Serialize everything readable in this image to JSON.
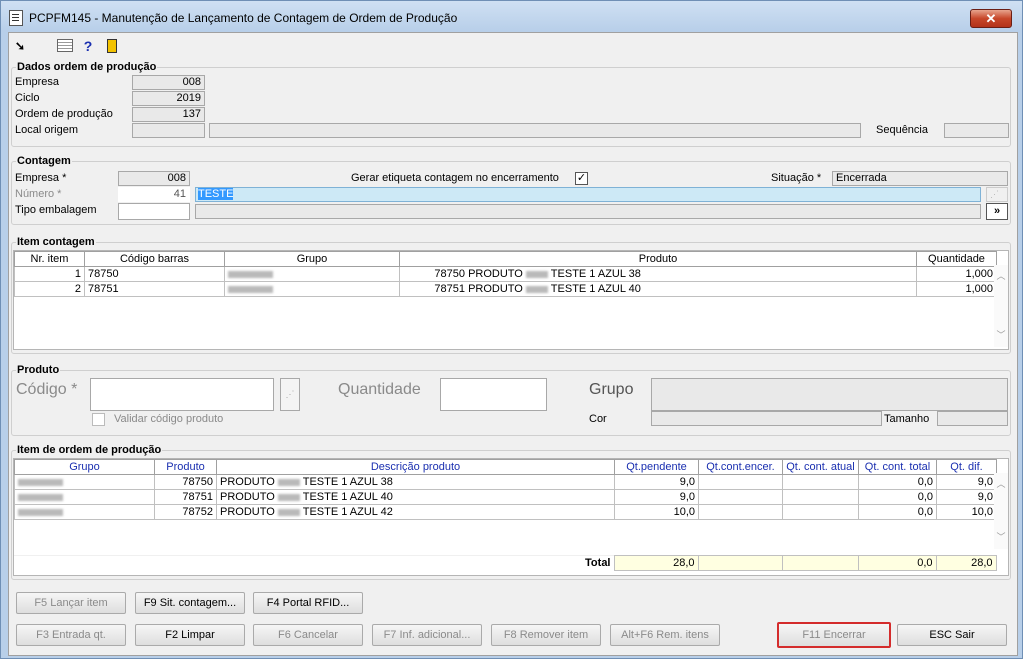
{
  "window": {
    "title": "PCPFM145 - Manutenção de Lançamento de Contagem de Ordem de Produção",
    "close": "✕"
  },
  "toolbar": {
    "icons": [
      "cursor-icon",
      "grid-icon",
      "help-icon",
      "exit-icon"
    ],
    "help_glyph": "?"
  },
  "dados": {
    "legend": "Dados ordem de produção",
    "empresa_label": "Empresa",
    "empresa": "008",
    "ciclo_label": "Ciclo",
    "ciclo": "2019",
    "ordem_label": "Ordem de produção",
    "ordem": "137",
    "local_label": "Local origem",
    "sequencia_label": "Sequência"
  },
  "contagem": {
    "legend": "Contagem",
    "empresa_label": "Empresa *",
    "empresa": "008",
    "numero_label": "Número *",
    "numero": "41",
    "descricao": "TESTE",
    "tipo_label": "Tipo embalagem",
    "gerar_label": "Gerar etiqueta contagem no encerramento",
    "gerar_checked": "✓",
    "situacao_label": "Situação *",
    "situacao": "Encerrada",
    "more": "»"
  },
  "item_contagem": {
    "legend": "Item contagem",
    "headers": [
      "Nr. item",
      "Código barras",
      "Grupo",
      "Produto",
      "Quantidade"
    ],
    "rows": [
      {
        "nr": "1",
        "codigo": "78750",
        "prod_cod": "78750",
        "prod_pre": "PRODUTO",
        "prod_suf": "TESTE 1 AZUL 38",
        "qtd": "1,000"
      },
      {
        "nr": "2",
        "codigo": "78751",
        "prod_cod": "78751",
        "prod_pre": "PRODUTO",
        "prod_suf": "TESTE 1 AZUL 40",
        "qtd": "1,000"
      }
    ]
  },
  "produto": {
    "legend": "Produto",
    "codigo_label": "Código *",
    "quantidade_label": "Quantidade",
    "grupo_label": "Grupo",
    "validar_label": "Validar código produto",
    "cor_label": "Cor",
    "tamanho_label": "Tamanho"
  },
  "item_ordem": {
    "legend": "Item de ordem de produção",
    "headers": [
      "Grupo",
      "Produto",
      "Descrição produto",
      "Qt.pendente",
      "Qt.cont.encer.",
      "Qt. cont. atual",
      "Qt. cont. total",
      "Qt. dif."
    ],
    "rows": [
      {
        "produto": "78750",
        "desc_pre": "PRODUTO",
        "desc_suf": "TESTE 1 AZUL 38",
        "pend": "9,0",
        "encer": "",
        "atual": "",
        "total": "0,0",
        "dif": "9,0"
      },
      {
        "produto": "78751",
        "desc_pre": "PRODUTO",
        "desc_suf": "TESTE 1 AZUL 40",
        "pend": "9,0",
        "encer": "",
        "atual": "",
        "total": "0,0",
        "dif": "9,0"
      },
      {
        "produto": "78752",
        "desc_pre": "PRODUTO",
        "desc_suf": "TESTE 1 AZUL 42",
        "pend": "10,0",
        "encer": "",
        "atual": "",
        "total": "0,0",
        "dif": "10,0"
      }
    ],
    "total_label": "Total",
    "total_pend": "28,0",
    "total_total": "0,0",
    "total_dif": "28,0"
  },
  "buttons": {
    "f5": "F5 Lançar item",
    "f9": "F9 Sit. contagem...",
    "f4": "F4 Portal RFID...",
    "f3": "F3 Entrada qt.",
    "f2": "F2 Limpar",
    "f6": "F6 Cancelar",
    "f7": "F7 Inf. adicional...",
    "f8": "F8 Remover item",
    "altf6": "Alt+F6 Rem. itens",
    "f11": "F11 Encerrar",
    "esc": "ESC Sair"
  },
  "colors": {
    "total_bg": "#ffffe1",
    "selection": "#3399ff",
    "field_focus": "#cde9f6",
    "highlight_border": "#d42c2c"
  }
}
